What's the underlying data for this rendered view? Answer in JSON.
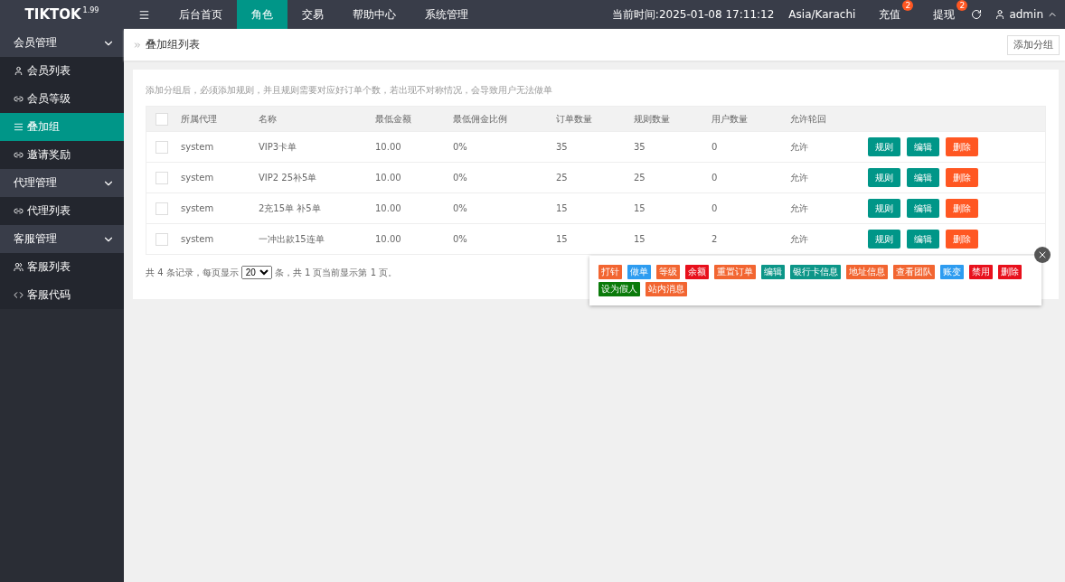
{
  "topbar": {
    "brand": "TIKTOK",
    "version": "1.99",
    "nav": [
      {
        "label": "后台首页",
        "selected": false
      },
      {
        "label": "角色",
        "selected": true
      },
      {
        "label": "交易",
        "selected": false
      },
      {
        "label": "帮助中心",
        "selected": false
      },
      {
        "label": "系统管理",
        "selected": false
      }
    ],
    "time": "当前时间:2025-01-08 17:11:12",
    "timezone": "Asia/Karachi",
    "actions": [
      {
        "label": "充值",
        "badge": "2"
      },
      {
        "label": "提现",
        "badge": "2"
      }
    ],
    "user": "admin"
  },
  "sidebar": [
    {
      "label": "会员管理",
      "expanded": true,
      "children": [
        {
          "label": "会员列表",
          "kind": "user",
          "selected": false
        },
        {
          "label": "会员等级",
          "kind": "link",
          "selected": false
        },
        {
          "label": "叠加组",
          "kind": "list",
          "selected": true
        },
        {
          "label": "邀请奖励",
          "kind": "link",
          "selected": false
        }
      ]
    },
    {
      "label": "代理管理",
      "expanded": true,
      "children": [
        {
          "label": "代理列表",
          "kind": "link",
          "selected": false
        }
      ]
    },
    {
      "label": "客服管理",
      "expanded": true,
      "children": [
        {
          "label": "客服列表",
          "kind": "users",
          "selected": false
        },
        {
          "label": "客服代码",
          "kind": "code",
          "selected": false
        }
      ]
    }
  ],
  "page": {
    "breadcrumb": "叠加组列表",
    "add_button": "添加分组",
    "notice": "添加分组后，必须添加规则，并且规则需要对应好订单个数，若出现不对称情况，会导致用户无法做单"
  },
  "table": {
    "all_checked": false,
    "columns": [
      "所属代理",
      "名称",
      "最低金额",
      "最低佣金比例",
      "订单数量",
      "规则数量",
      "用户数量",
      "允许轮回"
    ],
    "rows": [
      {
        "checked": false,
        "cells": [
          "system",
          "VIP3卡单",
          "10.00",
          "0%",
          "35",
          "35",
          "0",
          "允许"
        ],
        "actions": [
          "规则",
          "编辑",
          "删除"
        ]
      },
      {
        "checked": false,
        "cells": [
          "system",
          "VIP2 25补5单",
          "10.00",
          "0%",
          "25",
          "25",
          "0",
          "允许"
        ],
        "actions": [
          "规则",
          "编辑",
          "删除"
        ]
      },
      {
        "checked": false,
        "cells": [
          "system",
          "2充15单 补5单",
          "10.00",
          "0%",
          "15",
          "15",
          "0",
          "允许"
        ],
        "actions": [
          "规则",
          "编辑",
          "删除"
        ]
      },
      {
        "checked": false,
        "cells": [
          "system",
          "一冲出款15连单",
          "10.00",
          "0%",
          "15",
          "15",
          "2",
          "允许"
        ],
        "actions": [
          "规则",
          "编辑",
          "删除"
        ]
      }
    ]
  },
  "pagination": {
    "before": "共 4 条记录，每页显示",
    "page_size": "20",
    "after": "条，共 1 页当前显示第 1 页。"
  },
  "popup": {
    "tags": [
      {
        "label": "打针",
        "color": "#f26531"
      },
      {
        "label": "做单",
        "color": "#2d9cf0"
      },
      {
        "label": "等级",
        "color": "#f26531"
      },
      {
        "label": "余额",
        "color": "#e8101c"
      },
      {
        "label": "重置订单",
        "color": "#f26531"
      },
      {
        "label": "编辑",
        "color": "#0c9688"
      },
      {
        "label": "银行卡信息",
        "color": "#0c9688"
      },
      {
        "label": "地址信息",
        "color": "#f26531"
      },
      {
        "label": "查看团队",
        "color": "#f26531"
      },
      {
        "label": "账变",
        "color": "#2d9cf0"
      },
      {
        "label": "禁用",
        "color": "#e8101c"
      },
      {
        "label": "删除",
        "color": "#e8101c"
      },
      {
        "label": "设为假人",
        "color": "#0a7a0a"
      },
      {
        "label": "站内消息",
        "color": "#f26531"
      }
    ]
  }
}
